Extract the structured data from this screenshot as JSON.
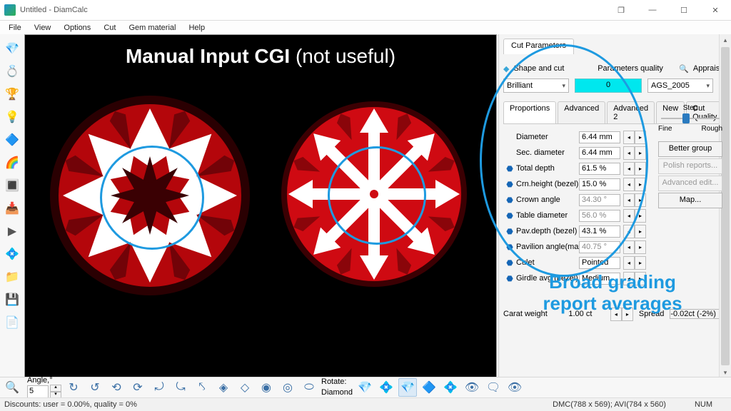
{
  "window": {
    "title": "Untitled - DiamCalc",
    "min_icon": "—",
    "max_icon": "☐",
    "restore_icon": "🗗",
    "maximize_alt_icon": "❐",
    "close_icon": "✕"
  },
  "menu": [
    "File",
    "View",
    "Options",
    "Cut",
    "Gem material",
    "Help"
  ],
  "viewport": {
    "overlay_bold": "Manual Input CGI",
    "overlay_light": " (not useful)"
  },
  "annotations": {
    "broad_grading": "Broad grading\nreport averages"
  },
  "cut_panel": {
    "tab": "Cut Parameters",
    "shape_label": "Shape and cut",
    "paramq_label": "Parameters quality",
    "appraiser_label": "Appraiser",
    "shape_value": "Brilliant",
    "paramq_value": "0",
    "appraiser_value": "AGS_2005",
    "subtabs": [
      "Proportions",
      "Advanced",
      "Advanced 2",
      "New",
      "Cut Quality"
    ],
    "step_label": "Step",
    "step_fine": "Fine",
    "step_rough": "Rough",
    "side_buttons": [
      "Better group",
      "Polish reports...",
      "Advanced edit...",
      "Map..."
    ],
    "props": [
      {
        "label": "Diameter",
        "value": "6.44 mm",
        "disabled": false,
        "icon": ""
      },
      {
        "label": "Sec. diameter",
        "value": "6.44 mm",
        "disabled": false,
        "icon": ""
      },
      {
        "label": "Total depth",
        "value": "61.5 %",
        "disabled": false,
        "icon": "⬣"
      },
      {
        "label": "Crn.height (bezel)",
        "value": "15.0 %",
        "disabled": false,
        "icon": "⬣"
      },
      {
        "label": "Crown angle",
        "value": "34.30 °",
        "disabled": true,
        "icon": "⬣"
      },
      {
        "label": "Table diameter",
        "value": "56.0 %",
        "disabled": true,
        "icon": "⬣"
      },
      {
        "label": "Pav.depth (bezel)",
        "value": "43.1 %",
        "disabled": false,
        "icon": "⬣"
      },
      {
        "label": "Pavilion angle(max)",
        "value": "40.75 °",
        "disabled": true,
        "icon": "⬣"
      },
      {
        "label": "Culet",
        "value": "Pointed",
        "disabled": false,
        "icon": "⬣"
      },
      {
        "label": "Girdle avg (bezel)",
        "value": "Medium",
        "disabled": false,
        "icon": "⬣"
      }
    ],
    "carat_label": "Carat weight",
    "carat_value": "1.00 ct",
    "spread_label": "Spread",
    "spread_value": "-0.02ct (-2%)"
  },
  "toolbar_icons": {
    "left": [
      "💎",
      "💍",
      "🏆",
      "💡",
      "🔷",
      "🌈",
      "🔳",
      "📥",
      "▶",
      "💠",
      "📁",
      "💾",
      "📄"
    ],
    "bottom": [
      "🔍"
    ]
  },
  "bottom": {
    "angle_label": "Angle,°",
    "angle_value": "5",
    "rotate_label": "Rotate:",
    "rotate_value": "Diamond",
    "arrow_icons": [
      "↻",
      "↺",
      "⟲",
      "⟳",
      "⤾",
      "⤿",
      "⤣"
    ],
    "render_icons": [
      "◈",
      "◇",
      "◉",
      "◎",
      "⬭"
    ],
    "diamond_icons": [
      "💎",
      "💠",
      "💎",
      "🔷",
      "💠"
    ],
    "eye_icons": [
      "👁",
      "🗨",
      "👁"
    ]
  },
  "status": {
    "left": "Discounts: user = 0.00%, quality = 0%",
    "coords": "DMC(788 x 569); AVI(784 x 560)",
    "num": "NUM"
  }
}
